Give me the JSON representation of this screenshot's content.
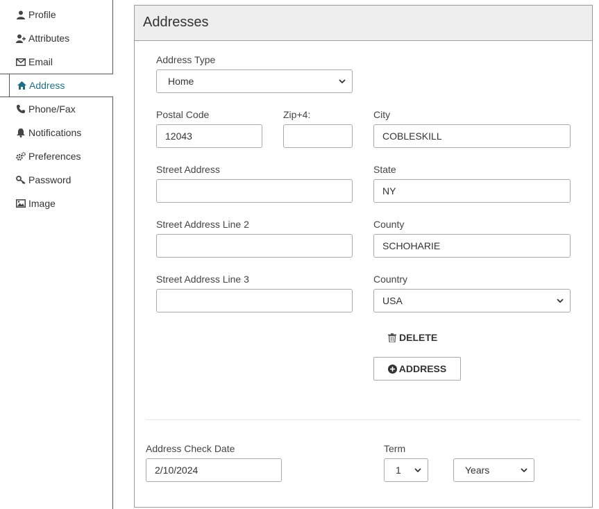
{
  "sidebar": {
    "items": [
      {
        "label": "Profile",
        "icon": "user-icon"
      },
      {
        "label": "Attributes",
        "icon": "user-plus-icon"
      },
      {
        "label": "Email",
        "icon": "envelope-icon"
      },
      {
        "label": "Address",
        "icon": "home-icon"
      },
      {
        "label": "Phone/Fax",
        "icon": "phone-icon"
      },
      {
        "label": "Notifications",
        "icon": "bell-icon"
      },
      {
        "label": "Preferences",
        "icon": "gears-icon"
      },
      {
        "label": "Password",
        "icon": "key-icon"
      },
      {
        "label": "Image",
        "icon": "image-icon"
      }
    ],
    "active_color": "#1f6e86"
  },
  "panel": {
    "title": "Addresses",
    "address_type": {
      "label": "Address Type",
      "value": "Home"
    },
    "postal_code": {
      "label": "Postal Code",
      "value": "12043"
    },
    "zip4": {
      "label": "Zip+4:",
      "value": ""
    },
    "city": {
      "label": "City",
      "value": "COBLESKILL"
    },
    "street1": {
      "label": "Street Address",
      "value": ""
    },
    "state": {
      "label": "State",
      "value": "NY"
    },
    "street2": {
      "label": "Street Address Line 2",
      "value": ""
    },
    "county": {
      "label": "County",
      "value": "SCHOHARIE"
    },
    "street3": {
      "label": "Street Address Line 3",
      "value": ""
    },
    "country": {
      "label": "Country",
      "value": "USA"
    },
    "delete_label": "DELETE",
    "add_address_label": "ADDRESS",
    "check_date": {
      "label": "Address Check Date",
      "value": "2/10/2024"
    },
    "term": {
      "label": "Term",
      "value": "1",
      "unit": "Years"
    }
  }
}
